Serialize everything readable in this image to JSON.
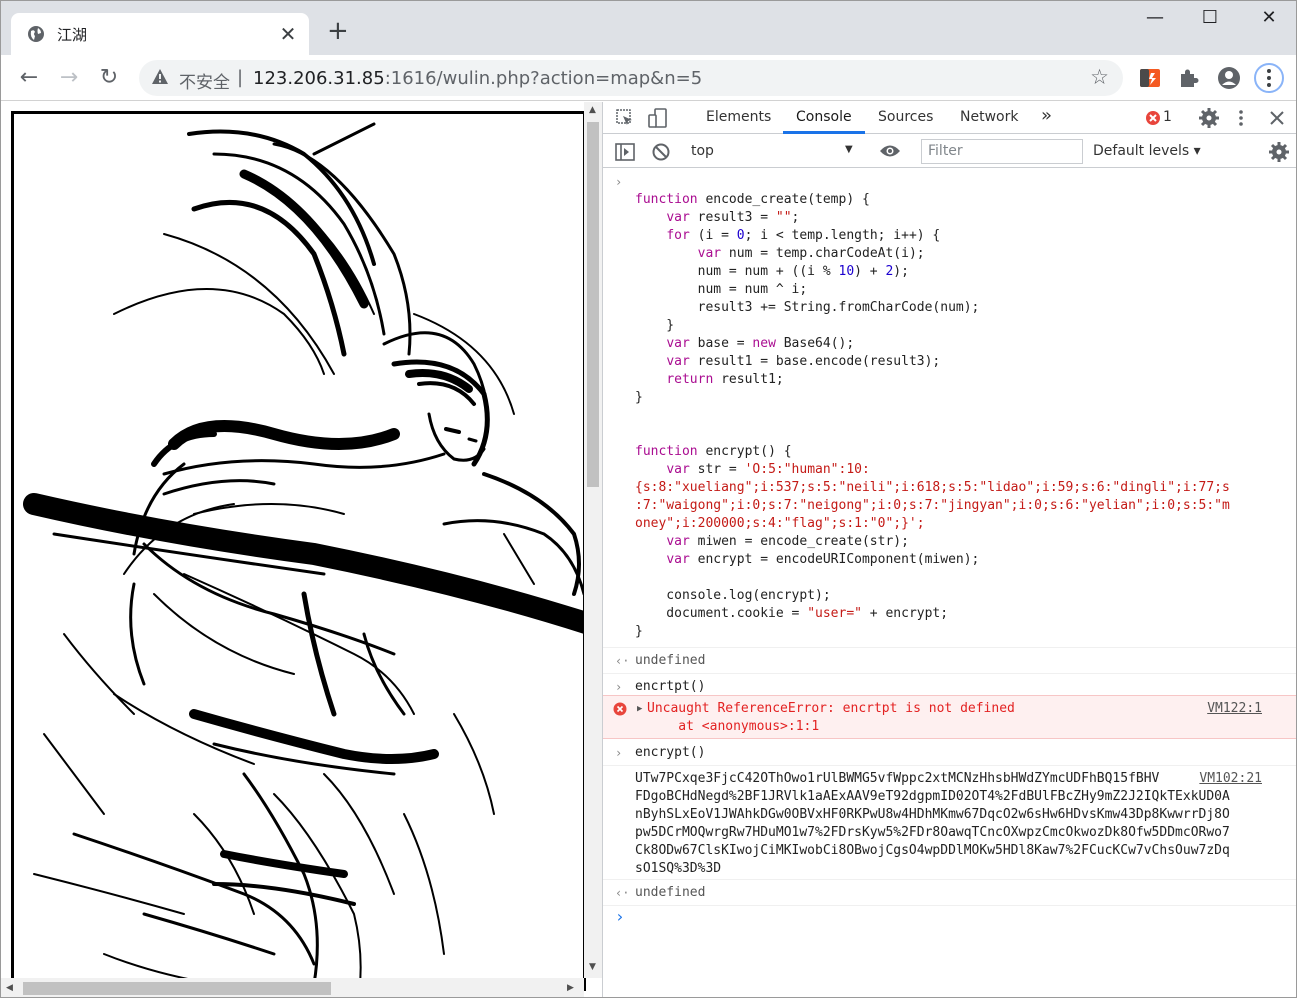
{
  "tab": {
    "title": "江湖",
    "close": "✕"
  },
  "window_controls": {
    "minimize": "—",
    "maximize": "☐",
    "close": "✕"
  },
  "toolbar": {
    "insecure_label": "不安全",
    "separator": "|",
    "url_host": "123.206.31.85",
    "url_rest": ":1616/wulin.php?action=map&n=5"
  },
  "devtools": {
    "tabs": [
      "Elements",
      "Console",
      "Sources",
      "Network"
    ],
    "more_tabs": "»",
    "error_count": "1",
    "context": "top",
    "filter_placeholder": "Filter",
    "levels": "Default levels ▾"
  },
  "console": {
    "code_lines": [
      "function encode_create(temp) {",
      "    var result3 = \"\";",
      "    for (i = 0; i < temp.length; i++) {",
      "        var num = temp.charCodeAt(i);",
      "        num = num + ((i % 10) + 2);",
      "        num = num ^ i;",
      "        result3 += String.fromCharCode(num);",
      "    }",
      "    var base = new Base64();",
      "    var result1 = base.encode(result3);",
      "    return result1;",
      "}",
      "",
      "",
      "function encrypt() {",
      "    var str = 'O:5:\"human\":10:",
      "{s:8:\"xueliang\";i:537;s:5:\"neili\";i:618;s:5:\"lidao\";i:59;s:6:\"dingli\";i:77;s",
      ":7:\"waigong\";i:0;s:7:\"neigong\";i:0;s:7:\"jingyan\";i:0;s:6:\"yelian\";i:0;s:5:\"m",
      "oney\";i:200000;s:4:\"flag\";s:1:\"0\";}';",
      "    var miwen = encode_create(str);",
      "    var encrypt = encodeURIComponent(miwen);",
      "",
      "    console.log(encrypt);",
      "    document.cookie = \"user=\" + encrypt;",
      "}"
    ],
    "undefined1": "undefined",
    "input2": "encrtpt()",
    "error_line1": "Uncaught ReferenceError: encrtpt is not defined",
    "error_line2": "    at <anonymous>:1:1",
    "error_src": "VM122:1",
    "input3": "encrypt()",
    "output_lines": [
      "UTw7PCxqe3FjcC42OThOwo1rUlBWMG5vfWppc2xtMCNzHhsbHWdZYmcUDFhBQ15fBHV",
      "FDgoBCHdNegd%2BF1JRVlk1aAExAAV9eT92dgpmID02OT4%2FdBUlFBcZHy9mZ2J2IQkTExkUD0A",
      "nByhSLxEoV1JWAhkDGw0OBVxHF0RKPwU8w4HDhMKmw67DqcO2w6sHw6HDvsKmw43Dp8KwwrrDj8O",
      "pw5DCrMOQwrgRw7HDuMO1w7%2FDrsKyw5%2FDr8OawqTCncOXwpzCmcOkwozDk8Ofw5DDmcORwo7",
      "Ck8ODw67ClsKIwojCiMKIwobCi8OBwojCgsO4wpDDlMOKw5HDl8Kaw7%2FCucKCw7vChsOuw7zDq",
      "sO1SQ%3D%3D"
    ],
    "output_src": "VM102:21",
    "undefined2": "undefined",
    "prompt": "›"
  }
}
